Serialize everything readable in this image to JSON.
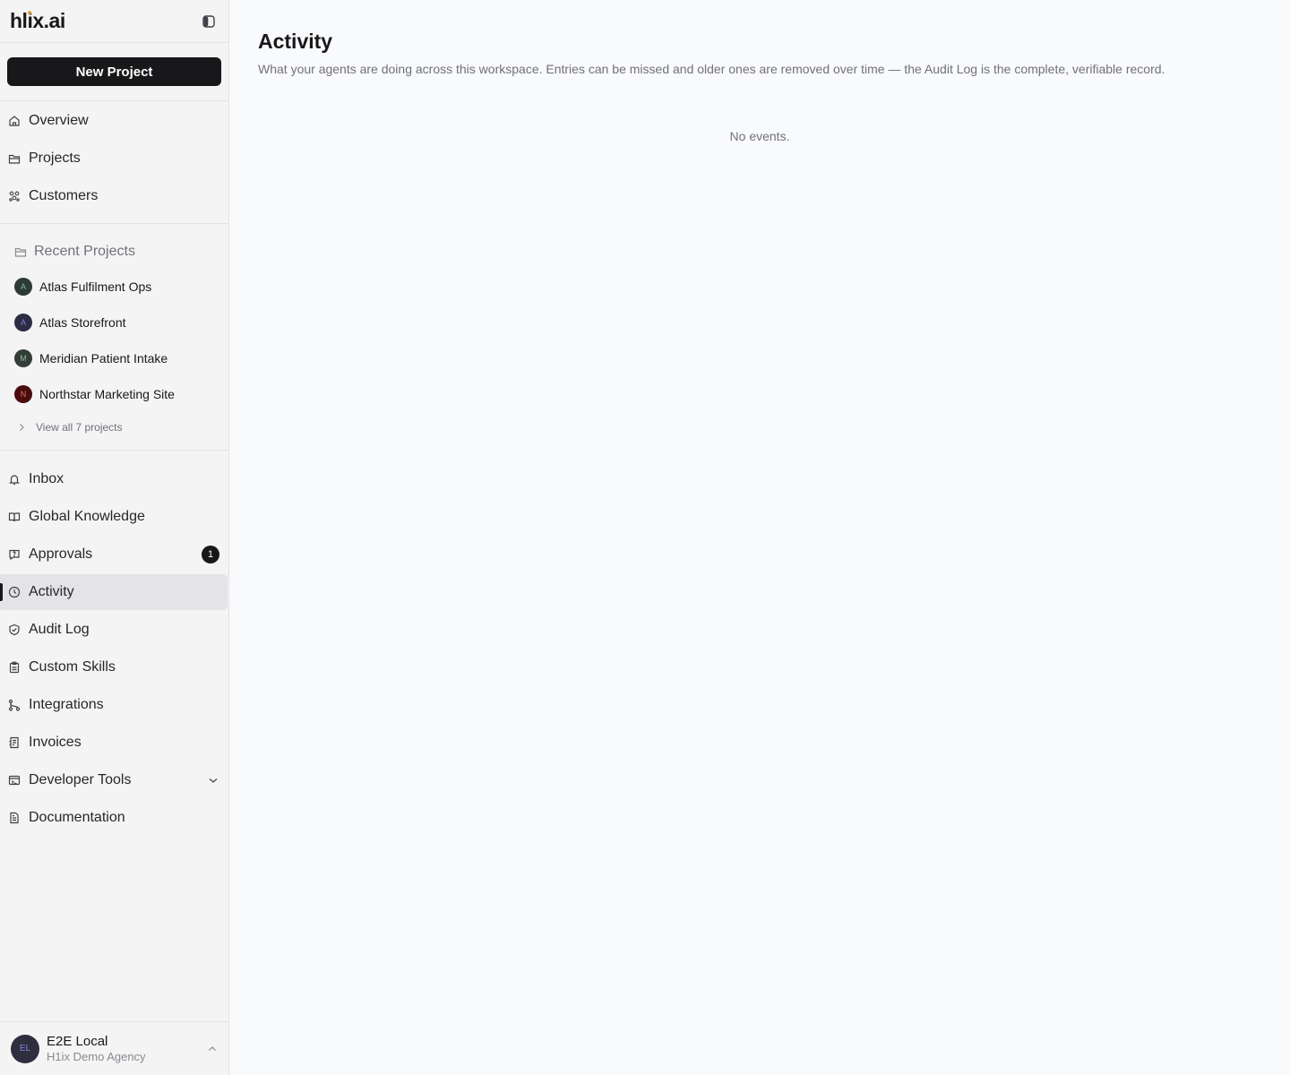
{
  "brand": {
    "logo_pre": "hl",
    "logo_i": "i",
    "logo_post": "x.ai"
  },
  "sidebar": {
    "new_project_label": "New Project",
    "primary": [
      {
        "label": "Overview",
        "icon": "home-icon"
      },
      {
        "label": "Projects",
        "icon": "folder-icon"
      },
      {
        "label": "Customers",
        "icon": "users-icon"
      }
    ],
    "recent": {
      "heading": "Recent Projects",
      "projects": [
        {
          "name": "Atlas Fulfilment Ops",
          "initial": "A",
          "bg": "#2d3a35",
          "fg": "#7bb89a"
        },
        {
          "name": "Atlas Storefront",
          "initial": "A",
          "bg": "#2c2c45",
          "fg": "#8a7dd8"
        },
        {
          "name": "Meridian Patient Intake",
          "initial": "M",
          "bg": "#333d38",
          "fg": "#8fb09f"
        },
        {
          "name": "Northstar Marketing Site",
          "initial": "N",
          "bg": "#4a0d0d",
          "fg": "#e06a6a"
        }
      ],
      "view_all": "View all 7 projects"
    },
    "secondary": [
      {
        "label": "Inbox",
        "icon": "bell-icon"
      },
      {
        "label": "Global Knowledge",
        "icon": "book-icon"
      },
      {
        "label": "Approvals",
        "icon": "question-bubble-icon",
        "badge": "1"
      },
      {
        "label": "Activity",
        "icon": "clock-icon",
        "active": true
      },
      {
        "label": "Audit Log",
        "icon": "shield-check-icon"
      },
      {
        "label": "Custom Skills",
        "icon": "clipboard-icon"
      },
      {
        "label": "Integrations",
        "icon": "git-branch-icon"
      },
      {
        "label": "Invoices",
        "icon": "receipt-icon"
      },
      {
        "label": "Developer Tools",
        "icon": "terminal-icon",
        "expandable": true
      },
      {
        "label": "Documentation",
        "icon": "document-icon"
      }
    ],
    "user": {
      "initials": "EL",
      "name": "E2E Local",
      "org": "H1ix Demo Agency"
    }
  },
  "main": {
    "title": "Activity",
    "description": "What your agents are doing across this workspace. Entries can be missed and older ones are removed over time — the Audit Log is the complete, verifiable record.",
    "empty_text": "No events."
  }
}
